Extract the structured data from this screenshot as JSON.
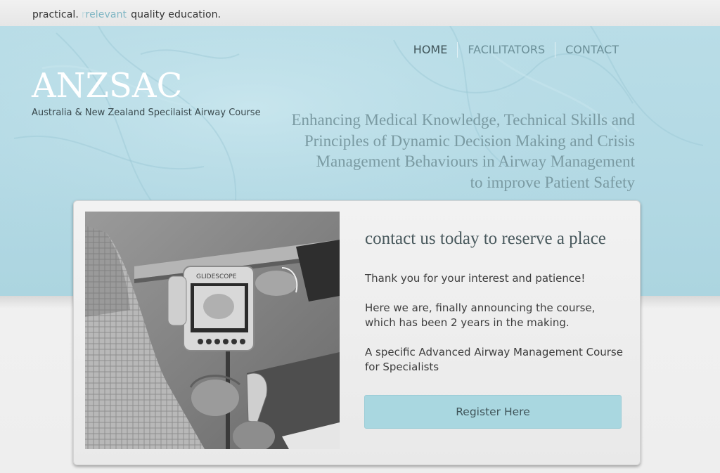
{
  "tagline": {
    "word1": "practical.",
    "word2": "relevant",
    "word3": "quality education."
  },
  "nav": {
    "items": [
      {
        "label": "HOME",
        "active": true
      },
      {
        "label": "FACILITATORS",
        "active": false
      },
      {
        "label": "CONTACT",
        "active": false
      }
    ]
  },
  "brand": {
    "logo": "ANZSAC",
    "subtitle": "Australia & New Zealand Specilaist Airway Course"
  },
  "headline": {
    "lines": [
      "Enhancing Medical Knowledge, Technical Skills and",
      "Principles of Dynamic Decision Making and Crisis",
      "Management Behaviours in Airway Management",
      "to improve Patient Safety"
    ]
  },
  "card": {
    "photo_label": "GLIDESCOPE",
    "title": "contact us today to reserve a place",
    "paragraphs": [
      "Thank you for your interest and patience!",
      "Here we are, finally announcing the course, which has been 2 years in the making.",
      "A specific Advanced Airway Management Course for Specialists"
    ],
    "register_label": "Register Here"
  },
  "colors": {
    "hero_blue": "#b3d9e4",
    "accent_text": "#7a9aa2",
    "button_bg": "#a9d7e0"
  }
}
